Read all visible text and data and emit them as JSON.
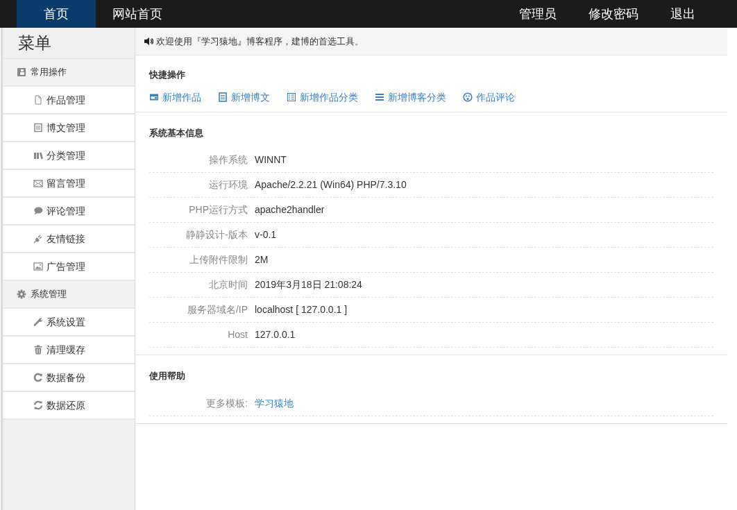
{
  "topnav": {
    "left": [
      {
        "label": "首页",
        "selected": true
      },
      {
        "label": "网站首页",
        "selected": false
      }
    ],
    "right": [
      "管理员",
      "修改密码",
      "退出"
    ]
  },
  "sidebar": {
    "title": "菜单",
    "groups": [
      {
        "label": "常用操作",
        "items": [
          "作品管理",
          "博文管理",
          "分类管理",
          "留言管理",
          "评论管理",
          "友情链接",
          "广告管理"
        ]
      },
      {
        "label": "系统管理",
        "items": [
          "系统设置",
          "清理缓存",
          "数据备份",
          "数据还原"
        ]
      }
    ]
  },
  "notice": "欢迎使用『学习猿地』博客程序，建博的首选工具。",
  "quick_actions": {
    "title": "快捷操作",
    "links": [
      "新增作品",
      "新增博文",
      "新增作品分类",
      "新增博客分类",
      "作品评论"
    ]
  },
  "system_info": {
    "title": "系统基本信息",
    "rows": [
      {
        "label": "操作系统",
        "value": "WINNT"
      },
      {
        "label": "运行环境",
        "value": "Apache/2.2.21 (Win64) PHP/7.3.10"
      },
      {
        "label": "PHP运行方式",
        "value": "apache2handler"
      },
      {
        "label": "静静设计-版本",
        "value": "v-0.1"
      },
      {
        "label": "上传附件限制",
        "value": "2M"
      },
      {
        "label": "北京时间",
        "value": "2019年3月18日 21:08:24"
      },
      {
        "label": "服务器域名/IP",
        "value": "localhost [ 127.0.0.1 ]"
      },
      {
        "label": "Host",
        "value": "127.0.0.1"
      }
    ]
  },
  "help": {
    "title": "使用帮助",
    "rows": [
      {
        "label": "更多模板:",
        "link": "学习猿地"
      }
    ]
  }
}
